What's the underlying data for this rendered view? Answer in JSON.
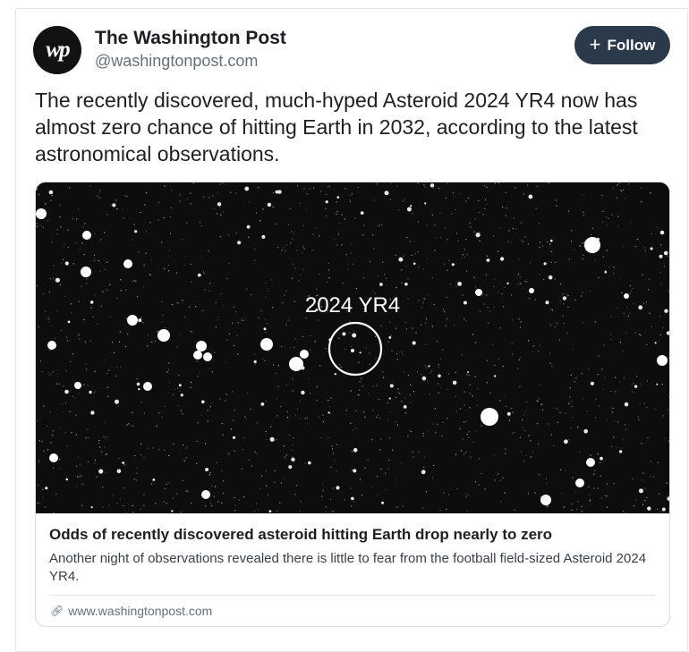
{
  "post": {
    "author_name": "The Washington Post",
    "author_handle": "@washingtonpost.com",
    "avatar_text": "wp",
    "follow_label": "Follow",
    "follow_icon": "plus-icon",
    "text": "The recently discovered, much-hyped Asteroid 2024 YR4 now has almost zero chance of hitting Earth in 2032, according to the latest astronomical observations."
  },
  "link_card": {
    "image_label": "2024 YR4",
    "title": "Odds of recently discovered asteroid hitting Earth drop nearly to zero",
    "description": "Another night of observations revealed there is little to fear from the football field-sized Asteroid 2024 YR4.",
    "domain": "www.washingtonpost.com",
    "domain_icon": "link-icon"
  },
  "colors": {
    "follow_button": "#2b3a4a",
    "image_background": "#0d0d0d"
  }
}
